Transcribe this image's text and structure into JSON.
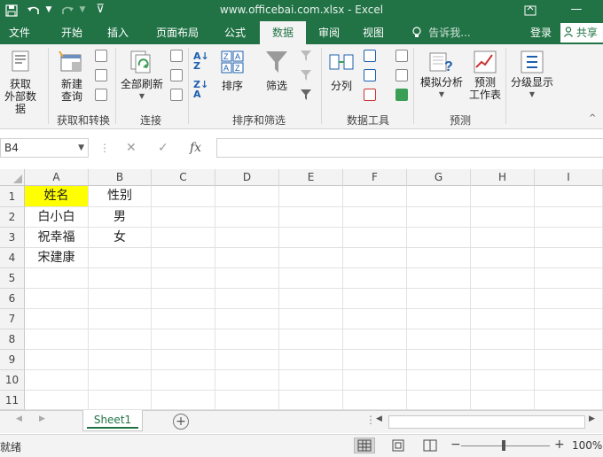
{
  "titlebar": {
    "title": "www.officebai.com.xlsx - Excel",
    "save_icon": "save-icon",
    "undo_icon": "undo-icon",
    "redo_icon": "redo-icon",
    "minimize_icon": "minimize-icon"
  },
  "tabs": [
    {
      "label": "文件"
    },
    {
      "label": "开始"
    },
    {
      "label": "插入"
    },
    {
      "label": "页面布局"
    },
    {
      "label": "公式"
    },
    {
      "label": "数据"
    },
    {
      "label": "审阅"
    },
    {
      "label": "视图"
    },
    {
      "label": "告诉我..."
    }
  ],
  "account": {
    "signin": "登录",
    "share": "共享"
  },
  "ribbon": {
    "get_external": "获取\n外部数据",
    "new_query": "新建\n查询",
    "refresh_all": "全部刷新",
    "sort": "排序",
    "filter": "筛选",
    "split": "分列",
    "what_if": "模拟分析",
    "forecast": "预测\n工作表",
    "outline": "分级显示",
    "groups": {
      "get_transform": "获取和转换",
      "connections": "连接",
      "sort_filter": "排序和筛选",
      "data_tools": "数据工具",
      "forecast": "预测"
    }
  },
  "formula_bar": {
    "namebox": "B4",
    "fx": "fx",
    "cancel": "✕",
    "enter": "✓",
    "value": ""
  },
  "columns": [
    "A",
    "B",
    "C",
    "D",
    "E",
    "F",
    "G",
    "H",
    "I"
  ],
  "rows": [
    "1",
    "2",
    "3",
    "4",
    "5",
    "6",
    "7",
    "8",
    "9",
    "10",
    "11"
  ],
  "cells": {
    "A1": "姓名",
    "B1": "性别",
    "A2": "白小白",
    "B2": "男",
    "A3": "祝幸福",
    "B3": "女",
    "A4": "宋建康"
  },
  "highlight_color": "#ffff00",
  "accent_color": "#217346",
  "sheet_tabs": [
    {
      "label": "Sheet1"
    }
  ],
  "status": {
    "ready": "就绪",
    "zoom": "100%"
  }
}
